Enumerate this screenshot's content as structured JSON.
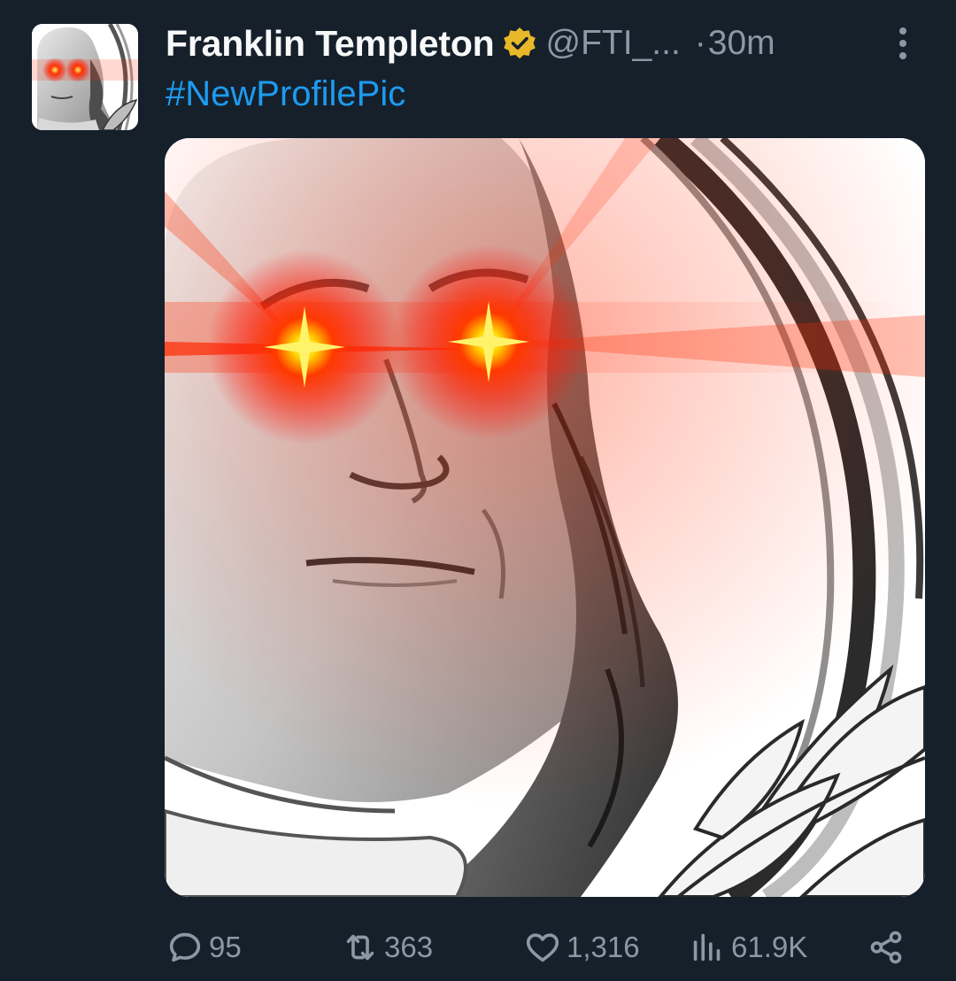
{
  "author": {
    "name": "Franklin Templeton",
    "handle": "@FTI_...",
    "separator": "·",
    "time": "30m",
    "verified_badge": "gold-verified-icon",
    "verified_color": "#e8b829"
  },
  "tweet": {
    "text": "#NewProfilePic"
  },
  "actions": {
    "replies": "95",
    "reposts": "363",
    "likes": "1,316",
    "views": "61.9K"
  },
  "icons": {
    "reply": "speech-bubble-icon",
    "repost": "repost-arrows-icon",
    "like": "heart-icon",
    "views": "bar-chart-icon",
    "share": "share-icon",
    "more": "kebab-menu-icon"
  },
  "colors": {
    "background": "#15202b",
    "text": "#f7f9f9",
    "muted": "#8b98a5",
    "link": "#1d9bf0",
    "laser": "#ff2a00"
  }
}
